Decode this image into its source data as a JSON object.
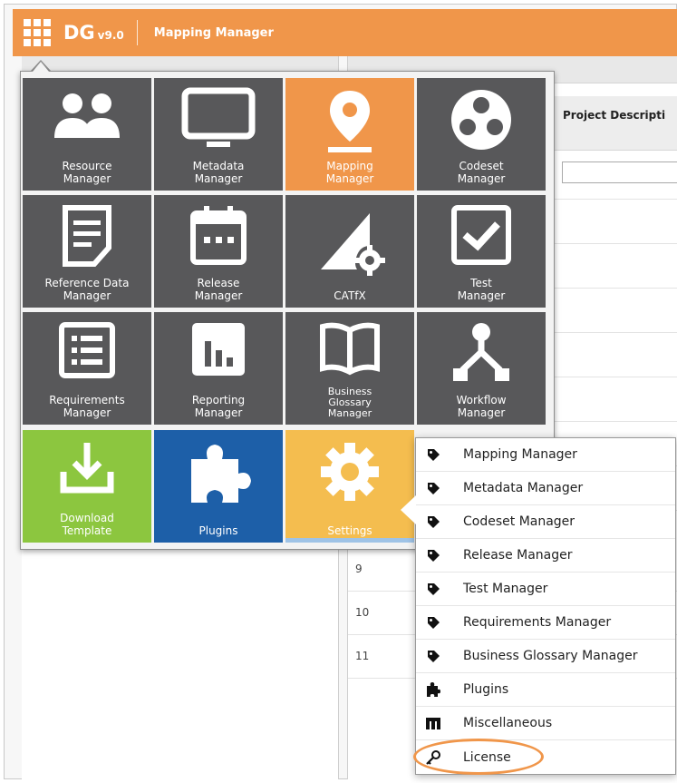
{
  "header": {
    "brand": "DG",
    "version": "v9.0",
    "app_title": "Mapping Manager"
  },
  "background": {
    "column_header": "Project Descripti",
    "row_numbers": [
      "9",
      "10",
      "11"
    ]
  },
  "launcher": {
    "tiles": [
      {
        "label": "Resource\nManager",
        "icon": "people-icon",
        "color": "#58585a"
      },
      {
        "label": "Metadata\nManager",
        "icon": "monitor-icon",
        "color": "#58585a"
      },
      {
        "label": "Mapping\nManager",
        "icon": "map-pin-icon",
        "color": "#f0964a"
      },
      {
        "label": "Codeset\nManager",
        "icon": "codeset-icon",
        "color": "#58585a"
      },
      {
        "label": "Reference Data\nManager",
        "icon": "document-icon",
        "color": "#58585a"
      },
      {
        "label": "Release\nManager",
        "icon": "calendar-icon",
        "color": "#58585a"
      },
      {
        "label": "CATfX",
        "icon": "catfx-icon",
        "color": "#58585a"
      },
      {
        "label": "Test\nManager",
        "icon": "checkbox-icon",
        "color": "#58585a"
      },
      {
        "label": "Requirements\nManager",
        "icon": "list-icon",
        "color": "#58585a"
      },
      {
        "label": "Reporting\nManager",
        "icon": "bar-chart-icon",
        "color": "#58585a"
      },
      {
        "label": "Business\nGlossary\nManager",
        "icon": "book-icon",
        "color": "#58585a"
      },
      {
        "label": "Workflow\nManager",
        "icon": "workflow-icon",
        "color": "#58585a"
      },
      {
        "label": "Download\nTemplate",
        "icon": "download-icon",
        "color": "#8cc63f"
      },
      {
        "label": "Plugins",
        "icon": "puzzle-icon",
        "color": "#1d5fa8"
      },
      {
        "label": "Settings",
        "icon": "gear-icon",
        "color": "#f4bd4f"
      }
    ]
  },
  "settings_menu": {
    "items": [
      {
        "label": "Mapping Manager",
        "icon": "tag-icon"
      },
      {
        "label": "Metadata Manager",
        "icon": "tag-icon"
      },
      {
        "label": "Codeset Manager",
        "icon": "tag-icon"
      },
      {
        "label": "Release Manager",
        "icon": "tag-icon"
      },
      {
        "label": "Test Manager",
        "icon": "tag-icon"
      },
      {
        "label": "Requirements Manager",
        "icon": "tag-icon"
      },
      {
        "label": "Business Glossary Manager",
        "icon": "tag-icon"
      },
      {
        "label": "Plugins",
        "icon": "puzzle-piece-icon"
      },
      {
        "label": "Miscellaneous",
        "icon": "m-icon"
      },
      {
        "label": "License",
        "icon": "key-icon"
      }
    ],
    "highlight_color": "#f0964a"
  }
}
